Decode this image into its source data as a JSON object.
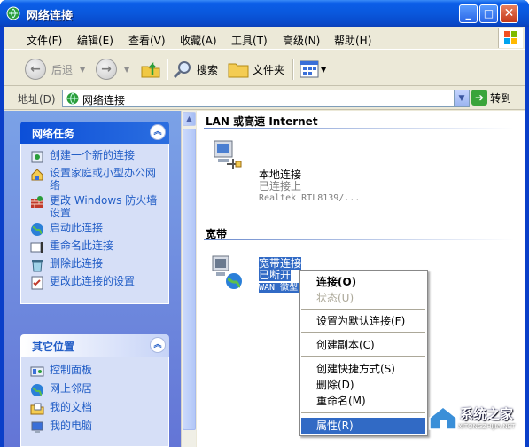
{
  "window": {
    "title": "网络连接"
  },
  "menubar": [
    "文件(F)",
    "编辑(E)",
    "查看(V)",
    "收藏(A)",
    "工具(T)",
    "高级(N)",
    "帮助(H)"
  ],
  "toolbar": {
    "back": "后退",
    "search": "搜索",
    "folders": "文件夹"
  },
  "address": {
    "label": "地址(D)",
    "value": "网络连接",
    "go": "转到"
  },
  "network_tasks": {
    "title": "网络任务",
    "items": [
      "创建一个新的连接",
      "设置家庭或小型办公网络",
      "更改 Windows 防火墙设置",
      "启动此连接",
      "重命名此连接",
      "删除此连接",
      "更改此连接的设置"
    ]
  },
  "other_places": {
    "title": "其它位置",
    "items": [
      "控制面板",
      "网上邻居",
      "我的文档",
      "我的电脑"
    ]
  },
  "groups": {
    "lan": {
      "title": "LAN 或高速 Internet",
      "item": {
        "name": "本地连接",
        "status": "已连接上",
        "device": "Realtek RTL8139/..."
      }
    },
    "broadband": {
      "title": "宽带",
      "item": {
        "name": "宽带连接",
        "status": "已断开",
        "device": "WAN 微型..."
      }
    }
  },
  "context_menu": [
    "连接(O)",
    "状态(U)",
    "设置为默认连接(F)",
    "创建副本(C)",
    "创建快捷方式(S)",
    "删除(D)",
    "重命名(M)",
    "属性(R)"
  ],
  "watermark": {
    "name": "系统之家",
    "url": "XITONGZHIJIA.NET"
  }
}
